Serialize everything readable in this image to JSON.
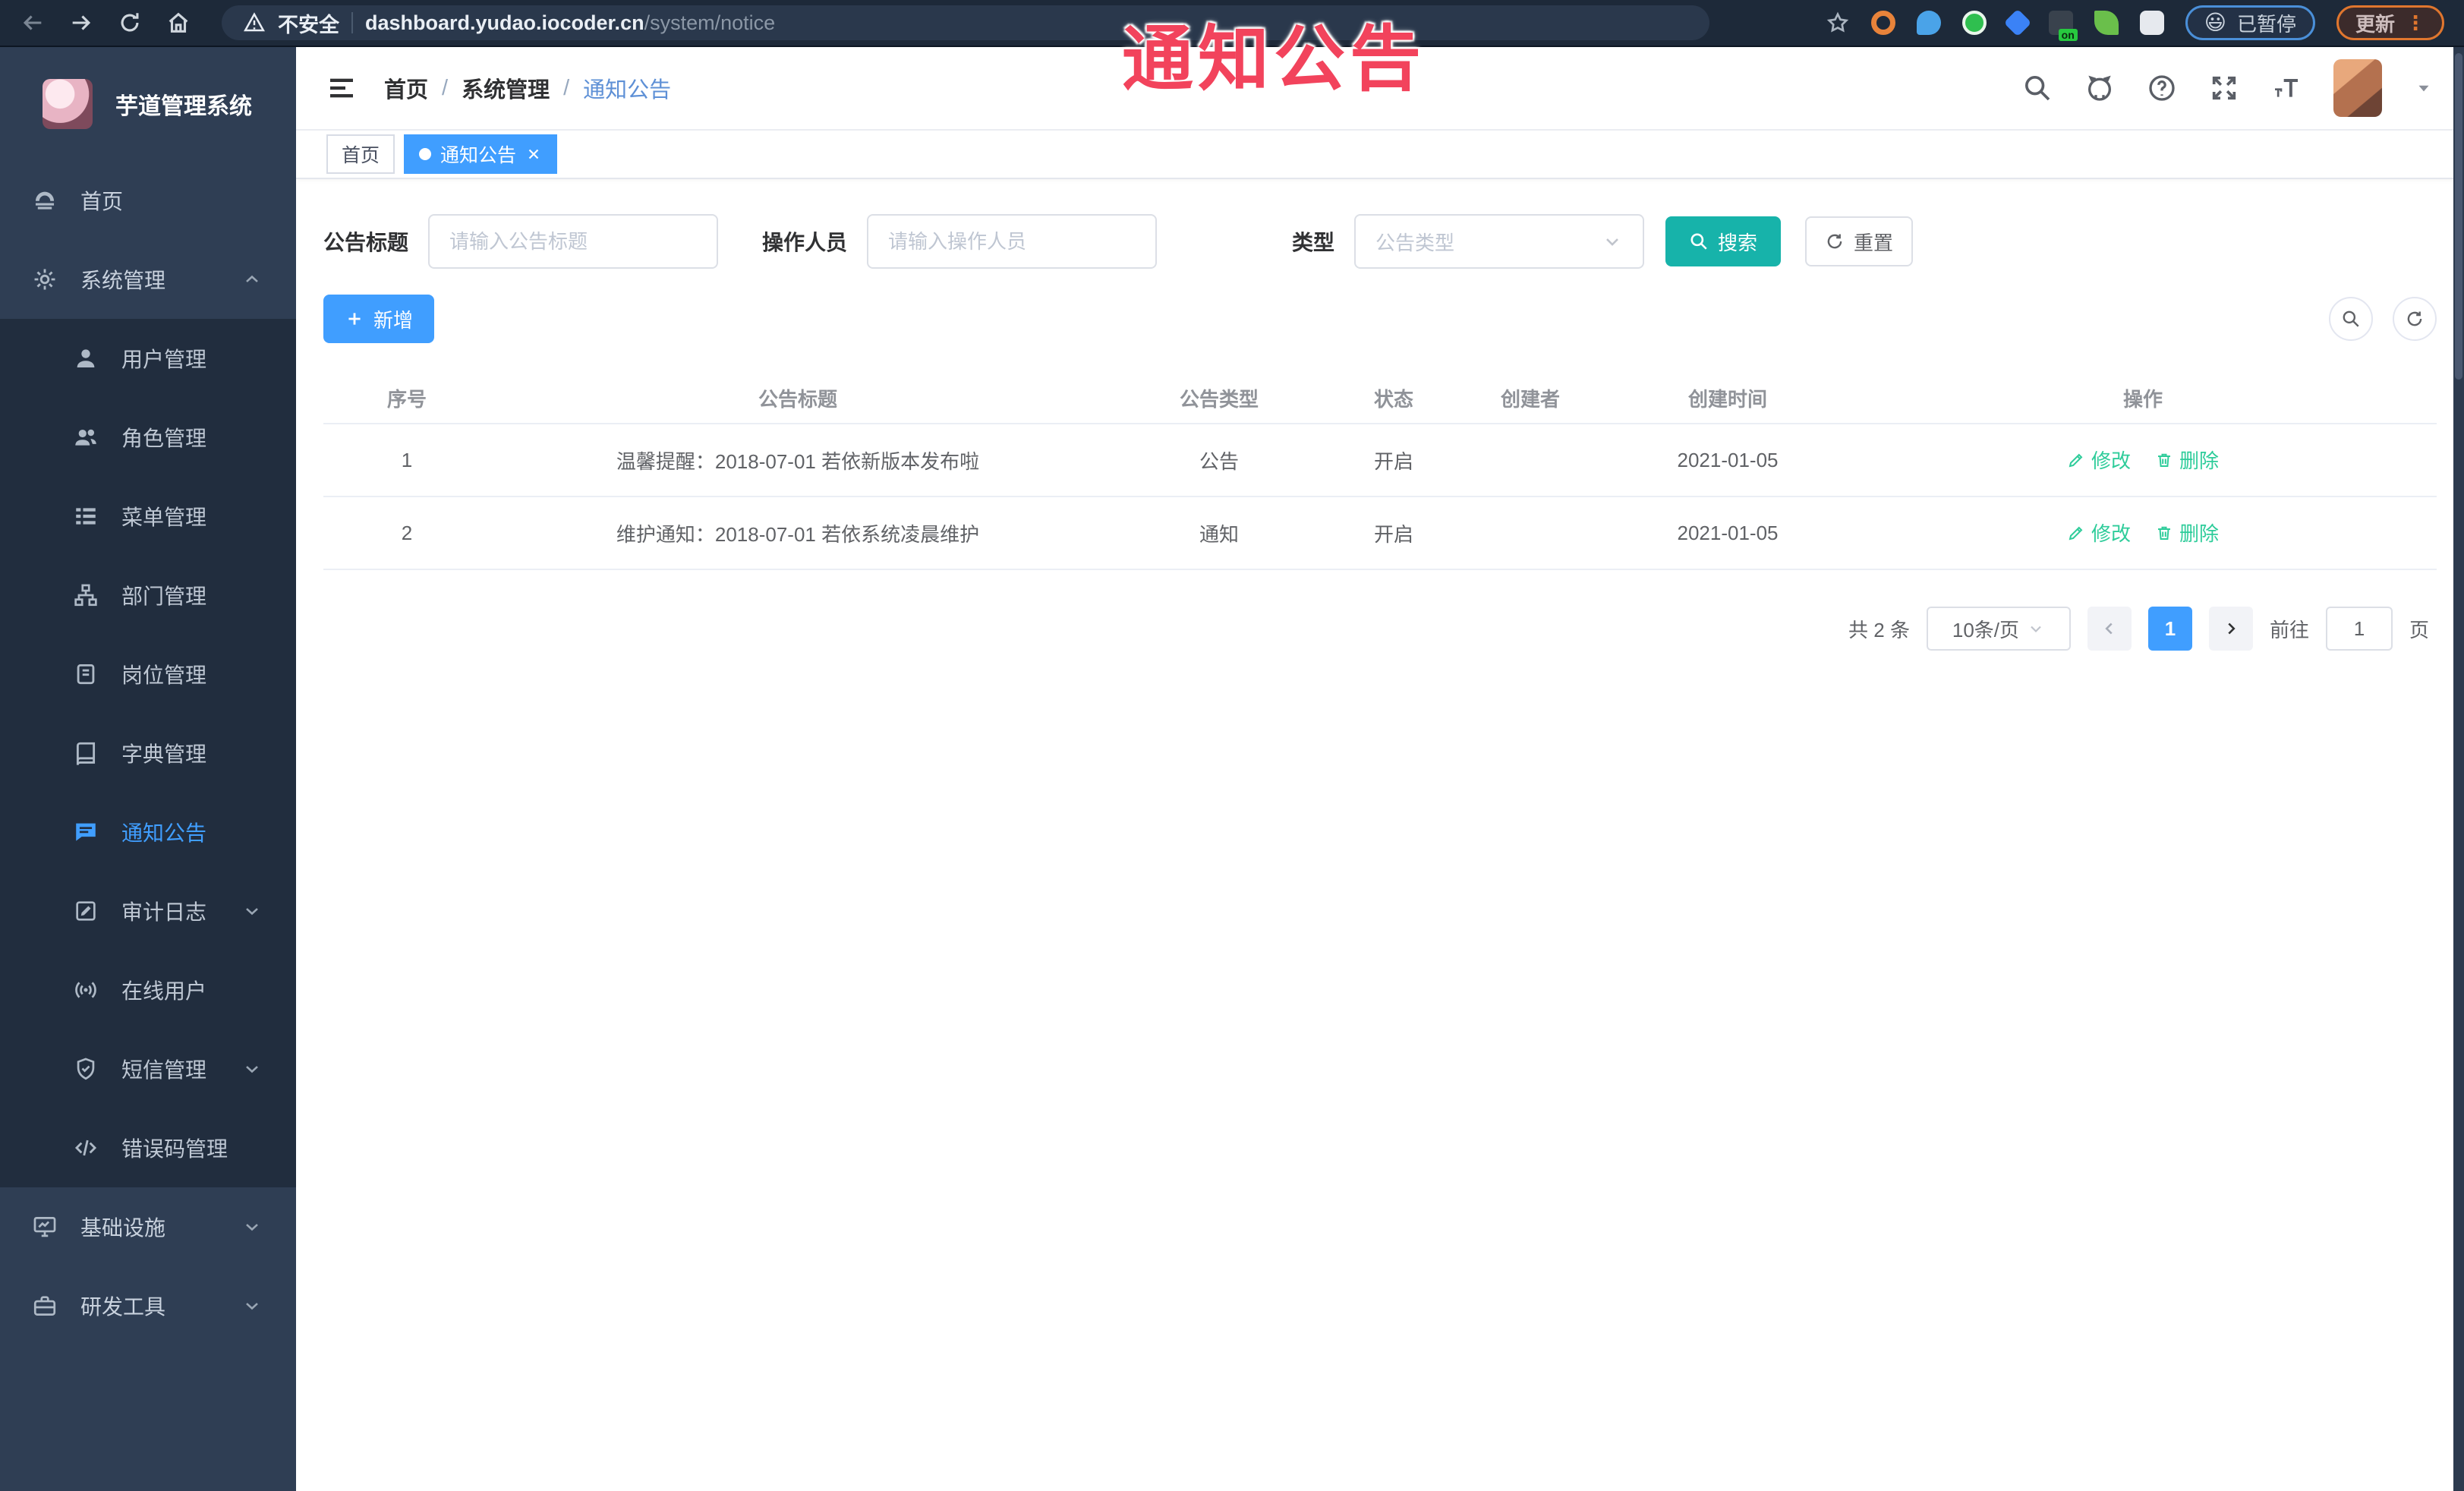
{
  "colors": {
    "primary_blue": "#409eff",
    "search_teal": "#17b3aa",
    "action_teal": "#2ecc9a",
    "sidebar_bg": "#2f3e54",
    "submenu_bg": "#212d3e",
    "annotation_red": "#f2435c"
  },
  "annotation": {
    "text": "通知公告"
  },
  "browser": {
    "security_label": "不安全",
    "url_domain": "dashboard.yudao.iocoder.cn",
    "url_path": "/system/notice",
    "extension_badge": "on",
    "paused_label": "已暂停",
    "update_label": "更新",
    "update_dots": "⋮"
  },
  "app": {
    "title": "芋道管理系统"
  },
  "sidebar": {
    "items": [
      {
        "label": "首页",
        "icon": "dashboard",
        "level": 1
      },
      {
        "label": "系统管理",
        "icon": "gear",
        "level": 1,
        "chevron": "up"
      },
      {
        "label": "用户管理",
        "icon": "user",
        "level": 2
      },
      {
        "label": "角色管理",
        "icon": "users",
        "level": 2
      },
      {
        "label": "菜单管理",
        "icon": "menu-list",
        "level": 2
      },
      {
        "label": "部门管理",
        "icon": "tree",
        "level": 2
      },
      {
        "label": "岗位管理",
        "icon": "id-badge",
        "level": 2
      },
      {
        "label": "字典管理",
        "icon": "book",
        "level": 2
      },
      {
        "label": "通知公告",
        "icon": "message",
        "level": 2,
        "active": true
      },
      {
        "label": "审计日志",
        "icon": "log",
        "level": 2,
        "chevron": "down"
      },
      {
        "label": "在线用户",
        "icon": "online",
        "level": 2
      },
      {
        "label": "短信管理",
        "icon": "shield",
        "level": 2,
        "chevron": "down"
      },
      {
        "label": "错误码管理",
        "icon": "code",
        "level": 2
      },
      {
        "label": "基础设施",
        "icon": "monitor",
        "level": 1,
        "chevron": "down"
      },
      {
        "label": "研发工具",
        "icon": "toolbox",
        "level": 1,
        "chevron": "down"
      }
    ]
  },
  "breadcrumb": {
    "items": [
      "首页",
      "系统管理",
      "通知公告"
    ],
    "separator": "/"
  },
  "tags": {
    "home": "首页",
    "active": "通知公告"
  },
  "filters": {
    "title_label": "公告标题",
    "title_placeholder": "请输入公告标题",
    "operator_label": "操作人员",
    "operator_placeholder": "请输入操作人员",
    "type_label": "类型",
    "type_placeholder": "公告类型",
    "search_label": "搜索",
    "reset_label": "重置"
  },
  "toolbar": {
    "add_label": "新增"
  },
  "table": {
    "columns": [
      "序号",
      "公告标题",
      "公告类型",
      "状态",
      "创建者",
      "创建时间",
      "操作"
    ],
    "rows": [
      {
        "no": "1",
        "title": "温馨提醒：2018-07-01 若依新版本发布啦",
        "type": "公告",
        "status": "开启",
        "creator": "",
        "created": "2021-01-05"
      },
      {
        "no": "2",
        "title": "维护通知：2018-07-01 若依系统凌晨维护",
        "type": "通知",
        "status": "开启",
        "creator": "",
        "created": "2021-01-05"
      }
    ],
    "edit_label": "修改",
    "delete_label": "删除"
  },
  "pagination": {
    "total": "共 2 条",
    "page_size": "10条/页",
    "current_page": "1",
    "goto_label": "前往",
    "goto_value": "1",
    "page_unit": "页"
  }
}
